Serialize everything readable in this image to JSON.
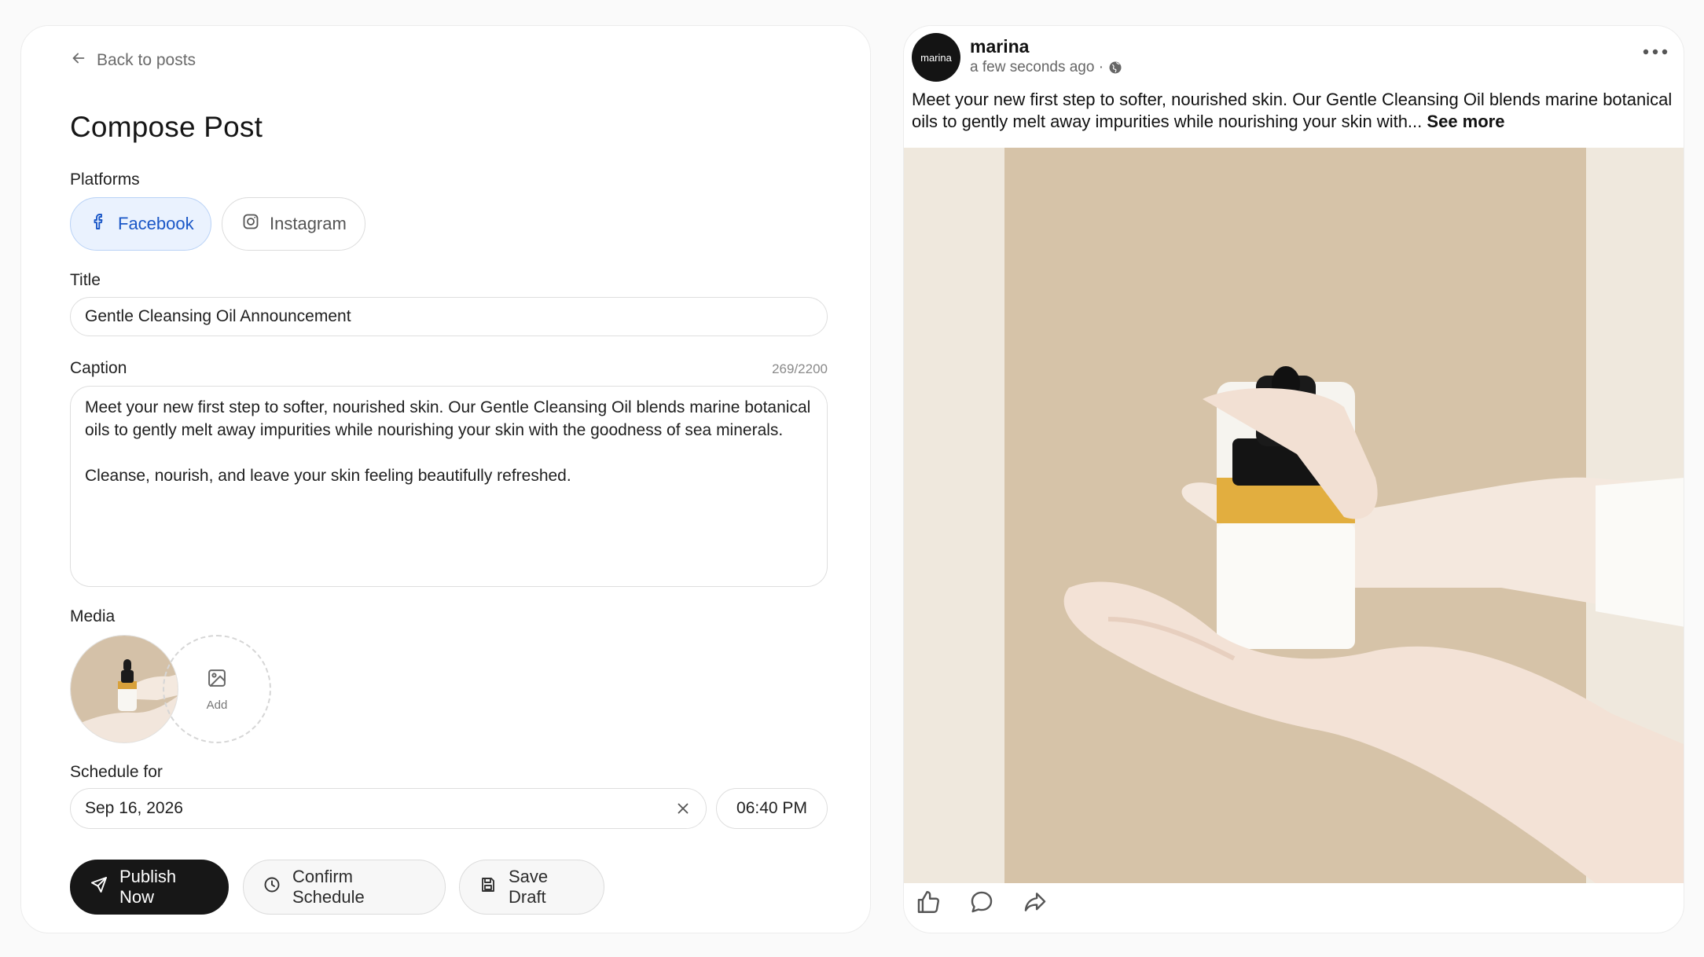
{
  "compose": {
    "back_label": "Back to posts",
    "heading": "Compose Post",
    "platforms_label": "Platforms",
    "platforms": [
      {
        "label": "Facebook",
        "icon": "facebook-icon",
        "selected": true
      },
      {
        "label": "Instagram",
        "icon": "instagram-icon",
        "selected": false
      }
    ],
    "title_label": "Title",
    "title_value": "Gentle Cleansing Oil Announcement",
    "caption_label": "Caption",
    "caption_counter": "269/2200",
    "caption_value": "Meet your new first step to softer, nourished skin. Our Gentle Cleansing Oil blends marine botanical oils to gently melt away impurities while nourishing your skin with the goodness of sea minerals.\n\nCleanse, nourish, and leave your skin feeling beautifully refreshed.",
    "media_label": "Media",
    "media_add_label": "Add",
    "schedule_label": "Schedule for",
    "schedule_date": "Sep 16, 2026",
    "schedule_time": "06:40 PM",
    "buttons": {
      "publish": "Publish Now",
      "confirm": "Confirm Schedule",
      "save": "Save Draft"
    }
  },
  "preview": {
    "avatar_text": "marina",
    "author": "marina",
    "timestamp": "a few seconds ago ·",
    "text": "Meet your new first step to softer, nourished skin. Our Gentle Cleansing Oil blends marine botanical oils to gently melt away impurities while nourishing your skin with...",
    "see_more": "See more",
    "actions": [
      "like-icon",
      "comment-icon",
      "share-icon"
    ]
  },
  "colors": {
    "accent": "#1a57c7",
    "accent_bg": "#eaf2fe",
    "primary_button": "#171717",
    "photo_backdrop": "#d6c3a8"
  }
}
